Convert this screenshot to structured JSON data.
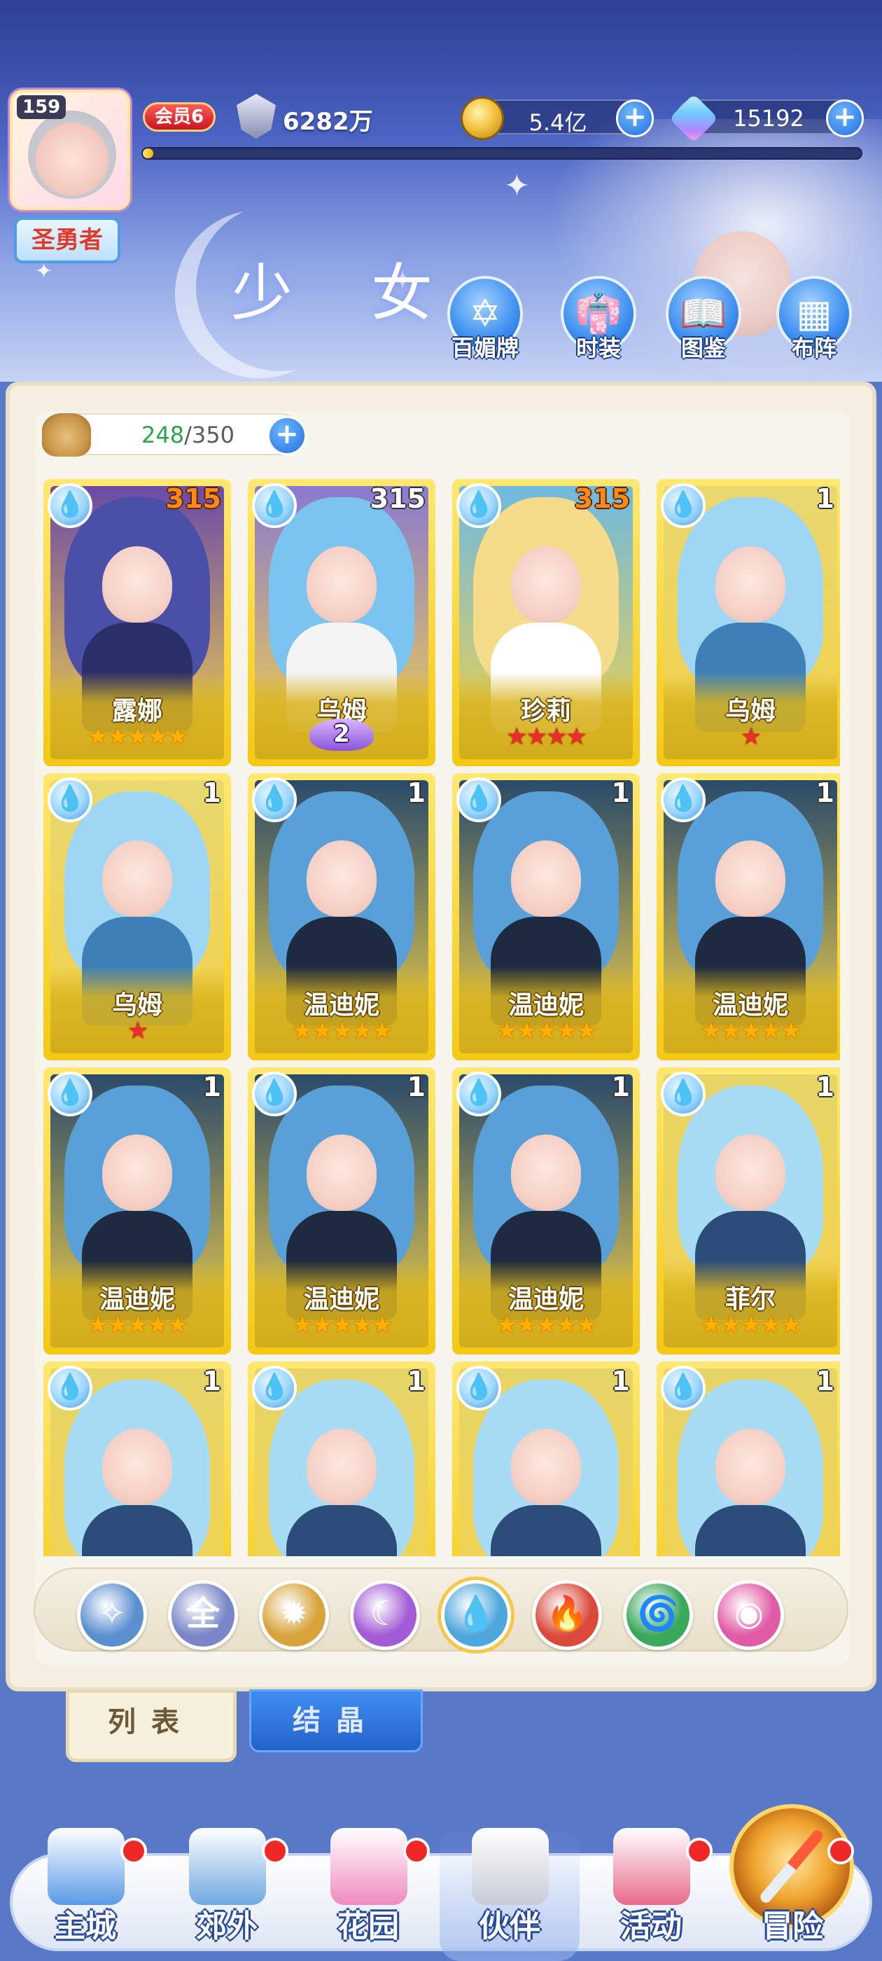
{
  "player": {
    "level": "159",
    "title": "圣勇者",
    "vip": "会员6",
    "power": "6282万",
    "exp_fraction": 0.015
  },
  "currency": {
    "gold": "5.4亿",
    "gems": "15192"
  },
  "page": {
    "title": "少 女"
  },
  "tools": [
    {
      "label": "百媚牌",
      "icon": "badge-icon"
    },
    {
      "label": "时装",
      "icon": "costume-icon"
    },
    {
      "label": "图鉴",
      "icon": "book-icon"
    },
    {
      "label": "布阵",
      "icon": "grid-formation-icon"
    }
  ],
  "capacity": {
    "current": "248",
    "separator": "/",
    "max": "350"
  },
  "cards": [
    {
      "name": "露娜",
      "level": "315",
      "level_style": "orange",
      "stars": "★★★★★",
      "star_color": "gold",
      "hair": "#4a4fa8",
      "body": "#2a2f6a",
      "bg": "#6b4aa6"
    },
    {
      "name": "乌姆",
      "level": "315",
      "level_style": "white",
      "badge": "2",
      "hair": "#7cc4f0",
      "body": "#f4f4f4",
      "bg": "#8a7ad0"
    },
    {
      "name": "珍莉",
      "level": "315",
      "level_style": "orange",
      "stars": "★★★★",
      "star_color": "red",
      "hair": "#f4dc8a",
      "body": "#ffffff",
      "bg": "#6fb9e0"
    },
    {
      "name": "乌姆",
      "level": "1",
      "level_style": "white",
      "stars": "★",
      "star_color": "red",
      "hair": "#9fd6f4",
      "body": "#3f7fb8",
      "bg": "#e8d870"
    },
    {
      "name": "乌姆",
      "level": "1",
      "level_style": "white",
      "stars": "★",
      "star_color": "red",
      "hair": "#9fd6f4",
      "body": "#3f7fb8",
      "bg": "#e8d870"
    },
    {
      "name": "温迪妮",
      "level": "1",
      "level_style": "white",
      "stars": "★★★★★",
      "star_color": "gold",
      "hair": "#5aa0d8",
      "body": "#1e2a40",
      "bg": "#2a4a6a"
    },
    {
      "name": "温迪妮",
      "level": "1",
      "level_style": "white",
      "stars": "★★★★★",
      "star_color": "gold",
      "hair": "#5aa0d8",
      "body": "#1e2a40",
      "bg": "#2a4a6a"
    },
    {
      "name": "温迪妮",
      "level": "1",
      "level_style": "white",
      "stars": "★★★★★",
      "star_color": "gold",
      "hair": "#5aa0d8",
      "body": "#1e2a40",
      "bg": "#2a4a6a"
    },
    {
      "name": "温迪妮",
      "level": "1",
      "level_style": "white",
      "stars": "★★★★★",
      "star_color": "gold",
      "hair": "#5aa0d8",
      "body": "#1e2a40",
      "bg": "#2a4a6a"
    },
    {
      "name": "温迪妮",
      "level": "1",
      "level_style": "white",
      "stars": "★★★★★",
      "star_color": "gold",
      "hair": "#5aa0d8",
      "body": "#1e2a40",
      "bg": "#2a4a6a"
    },
    {
      "name": "温迪妮",
      "level": "1",
      "level_style": "white",
      "stars": "★★★★★",
      "star_color": "gold",
      "hair": "#5aa0d8",
      "body": "#1e2a40",
      "bg": "#2a4a6a"
    },
    {
      "name": "菲尔",
      "level": "1",
      "level_style": "white",
      "stars": "★★★★★",
      "star_color": "gold",
      "hair": "#a8dcf4",
      "body": "#2c4c7a",
      "bg": "#e6d468"
    },
    {
      "name": "",
      "level": "1",
      "level_style": "white",
      "hair": "#a8dcf4",
      "body": "#2c4c7a",
      "bg": "#e6d468"
    },
    {
      "name": "",
      "level": "1",
      "level_style": "white",
      "hair": "#a8dcf4",
      "body": "#2c4c7a",
      "bg": "#e6d468"
    },
    {
      "name": "",
      "level": "1",
      "level_style": "white",
      "hair": "#a8dcf4",
      "body": "#2c4c7a",
      "bg": "#e6d468"
    },
    {
      "name": "",
      "level": "1",
      "level_style": "white",
      "hair": "#a8dcf4",
      "body": "#2c4c7a",
      "bg": "#e6d468"
    }
  ],
  "element_filters": [
    {
      "icon": "wind-rank-icon",
      "glyph": "✧",
      "color": "#5b8fd0"
    },
    {
      "icon": "all-icon",
      "glyph": "全",
      "color": "#7a86c8"
    },
    {
      "icon": "light-icon",
      "glyph": "✹",
      "color": "#d8a33a"
    },
    {
      "icon": "moon-icon",
      "glyph": "☾",
      "color": "#a35ad6"
    },
    {
      "icon": "water-icon",
      "glyph": "💧",
      "color": "#4da6dc",
      "selected": true
    },
    {
      "icon": "fire-icon",
      "glyph": "🔥",
      "color": "#d94a3a"
    },
    {
      "icon": "wind-icon",
      "glyph": "🌀",
      "color": "#3aa85a"
    },
    {
      "icon": "dark-icon",
      "glyph": "◉",
      "color": "#e05aa6"
    }
  ],
  "tabs": {
    "list": "列表",
    "crystal": "结晶"
  },
  "nav": [
    {
      "label": "主城",
      "icon": "castle-icon",
      "color": "#5b9ae8",
      "dot": true
    },
    {
      "label": "郊外",
      "icon": "portal-icon",
      "color": "#6ea8e0",
      "dot": true
    },
    {
      "label": "花园",
      "icon": "heart-garden-icon",
      "color": "#f08ac0",
      "dot": true
    },
    {
      "label": "伙伴",
      "icon": "partner-icon",
      "color": "#c8ccd8",
      "dot": false,
      "active": true
    },
    {
      "label": "活动",
      "icon": "gift-icon",
      "color": "#e86a8a",
      "dot": true
    },
    {
      "label": "冒险",
      "icon": "compass-icon",
      "color": "#f0a32e",
      "dot": true
    }
  ]
}
